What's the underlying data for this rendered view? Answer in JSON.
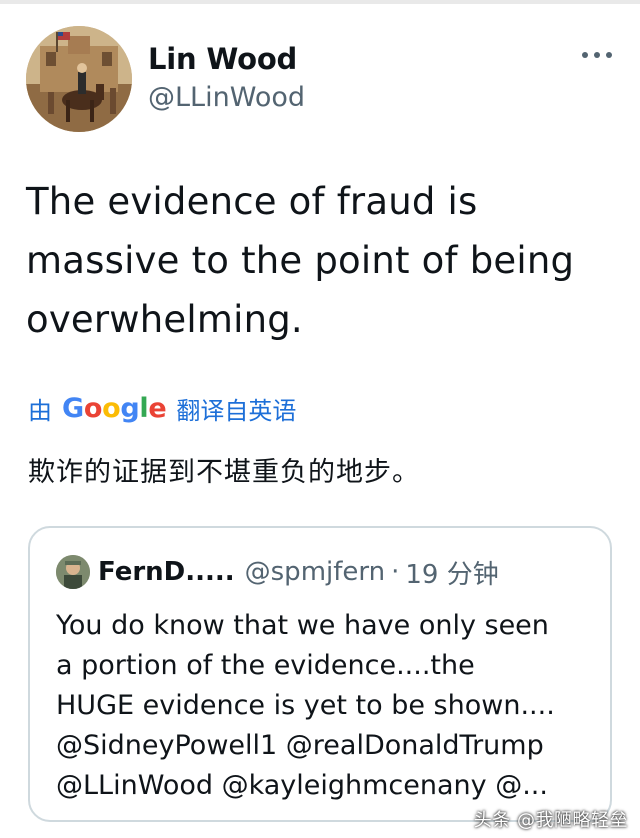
{
  "author": {
    "name": "Lin Wood",
    "handle": "@LLinWood"
  },
  "tweet": {
    "lines": [
      "The evidence of fraud is",
      "massive to the point of being",
      "overwhelming."
    ]
  },
  "translation": {
    "by_label": "由",
    "provider": "Google",
    "from_label": "翻译自英语",
    "translated_text": "欺诈的证据到不堪重负的地步。"
  },
  "quoted_tweet": {
    "name": "FernD.....",
    "handle": "@spmjfern",
    "separator": "·",
    "time": "19 分钟",
    "lines": [
      "You do know that we have only seen",
      "a portion of the evidence....the",
      "HUGE evidence is yet to be shown....",
      "@SidneyPowell1 @realDonaldTrump",
      "@LLinWood @kayleighmcenany @..."
    ]
  },
  "watermark": "头条 @我陋略轻垒",
  "icons": {
    "more": "more-horizontal-icon"
  }
}
